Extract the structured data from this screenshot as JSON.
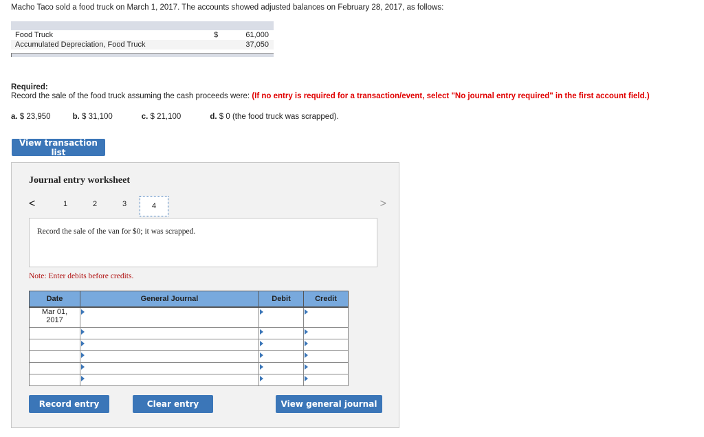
{
  "intro": "Macho Taco sold a food truck on March 1, 2017. The accounts showed adjusted balances on February 28, 2017, as follows:",
  "balances": [
    {
      "account": "Food Truck",
      "currency": "$",
      "amount": "61,000"
    },
    {
      "account": "Accumulated Depreciation, Food Truck",
      "currency": "",
      "amount": "37,050"
    }
  ],
  "required": {
    "label": "Required:",
    "text": "Record the sale of the food truck assuming the cash proceeds were: ",
    "instruction": "(If no entry is required for a  transaction/event, select \"No journal entry required\" in the first account field.)"
  },
  "parts": [
    {
      "letter": "a.",
      "text": " $ 23,950"
    },
    {
      "letter": "b.",
      "text": " $ 31,100"
    },
    {
      "letter": "c.",
      "text": " $ 21,100"
    },
    {
      "letter": "d.",
      "text": " $ 0 (the food truck was scrapped)."
    }
  ],
  "buttons": {
    "view_transaction_list": "View transaction list",
    "record_entry": "Record entry",
    "clear_entry": "Clear entry",
    "view_general_journal": "View general journal"
  },
  "worksheet": {
    "title": "Journal entry worksheet",
    "pager": {
      "prev": "<",
      "next": ">",
      "pages": [
        "1",
        "2",
        "3",
        "4"
      ],
      "active": "4"
    },
    "description": "Record the sale of the van for $0; it was scrapped.",
    "note": "Note: Enter debits before credits.",
    "table": {
      "headers": [
        "Date",
        "General Journal",
        "Debit",
        "Credit"
      ],
      "rows": [
        {
          "date_line1": "Mar 01,",
          "date_line2": "2017",
          "account": "",
          "debit": "",
          "credit": ""
        },
        {
          "date_line1": "",
          "date_line2": "",
          "account": "",
          "debit": "",
          "credit": ""
        },
        {
          "date_line1": "",
          "date_line2": "",
          "account": "",
          "debit": "",
          "credit": ""
        },
        {
          "date_line1": "",
          "date_line2": "",
          "account": "",
          "debit": "",
          "credit": ""
        },
        {
          "date_line1": "",
          "date_line2": "",
          "account": "",
          "debit": "",
          "credit": ""
        },
        {
          "date_line1": "",
          "date_line2": "",
          "account": "",
          "debit": "",
          "credit": ""
        }
      ]
    }
  }
}
